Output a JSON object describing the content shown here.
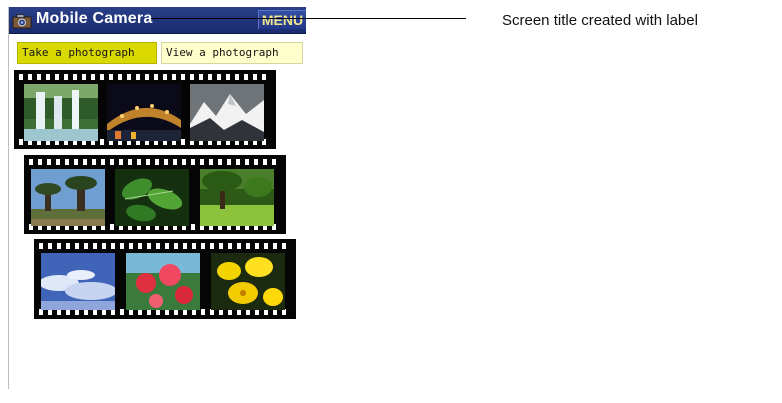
{
  "titlebar": {
    "title": "Mobile Camera",
    "menu_label": "MENU",
    "icon": "camera-icon"
  },
  "tabs": [
    {
      "label": "Take a photograph",
      "selected": true
    },
    {
      "label": "View a photograph",
      "selected": false
    }
  ],
  "film_strips": [
    {
      "photos": [
        "waterfall-photo",
        "night-bridge-photo",
        "snowy-mountain-photo"
      ]
    },
    {
      "photos": [
        "baobab-trees-photo",
        "green-leaves-photo",
        "park-lawn-photo"
      ]
    },
    {
      "photos": [
        "clouds-sky-photo",
        "red-flowers-photo",
        "yellow-flowers-photo"
      ]
    }
  ],
  "annotation": {
    "text": "Screen title created with label"
  },
  "colors": {
    "title_bar": "#1f3380",
    "menu_text": "#f1e68a",
    "tab_selected": "#d9d900",
    "tab_unselected": "#ffffcc"
  }
}
